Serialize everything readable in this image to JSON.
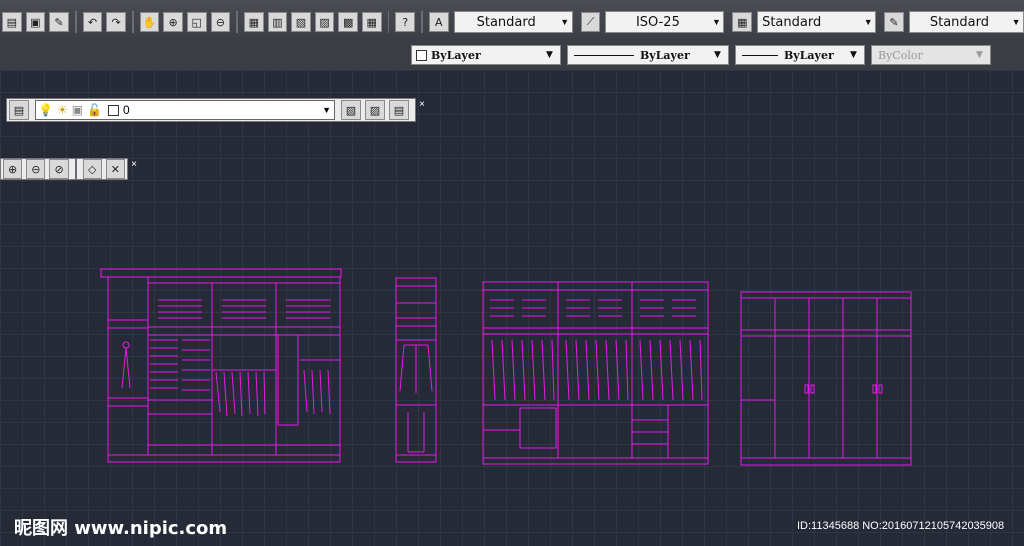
{
  "toolbar": {
    "text_style": "Standard",
    "dim_style": "ISO-25",
    "table_style": "Standard",
    "multileader_style": "Standard",
    "color": "ByLayer",
    "linetype": "ByLayer",
    "lineweight": "ByLayer",
    "plot_style": "ByColor",
    "help_label": "?"
  },
  "layers": {
    "current_layer": "0"
  },
  "watermark": {
    "site": "昵图网 www.nipic.com",
    "id": "ID:11345688 NO:20160712105742035908"
  },
  "colors": {
    "drawing": "#e81ae8",
    "canvas": "#252a36"
  }
}
